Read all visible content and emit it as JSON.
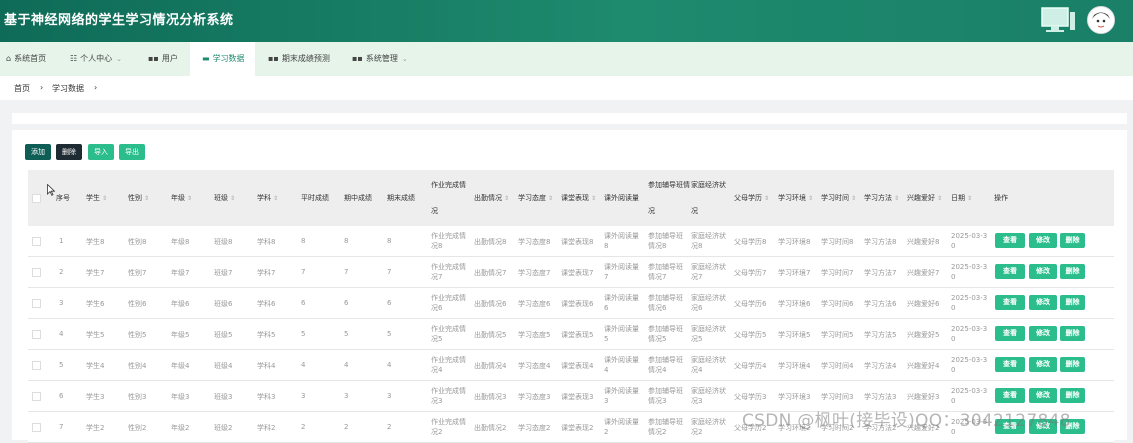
{
  "header": {
    "title": "基于神经网络的学生学习情况分析系统"
  },
  "nav": {
    "items": [
      {
        "label": "系统首页",
        "icon": "home-icon",
        "glyph": "⌂"
      },
      {
        "label": "个人中心",
        "icon": "calendar-icon",
        "glyph": "☷"
      },
      {
        "label": "用户",
        "icon": "grid-icon",
        "glyph": "▪▪"
      },
      {
        "label": "学习数据",
        "icon": "flag-icon",
        "glyph": "▬"
      },
      {
        "label": "期末成绩预测",
        "icon": "grid-icon",
        "glyph": "▪▪"
      },
      {
        "label": "系统管理",
        "icon": "grid-icon",
        "glyph": "▪▪"
      }
    ],
    "caret": "⌄"
  },
  "breadcrumb": {
    "home": "首页",
    "sep": "›",
    "current": "学习数据",
    "sep2": "›"
  },
  "toolbar": {
    "add": "添加",
    "delete": "删除",
    "import": "导入",
    "export": "导出"
  },
  "table": {
    "sort_glyph": "⇕",
    "headers": {
      "index": "序号",
      "student": "学生",
      "gender": "性别",
      "grade": "年级",
      "class": "班级",
      "subject": "学科",
      "usual": "平时成绩",
      "midterm": "期中成绩",
      "final": "期末成绩",
      "homework_a": "作业完成情",
      "homework_b": "况",
      "attendance": "出勤情况",
      "attitude": "学习态度",
      "classroom": "课堂表现",
      "reading": "课外阅读量",
      "tutoring_a": "参加辅导班情",
      "tutoring_b": "况",
      "economy_a": "家庭经济状",
      "economy_b": "况",
      "parent_edu": "父母学历",
      "environment": "学习环境",
      "study_time": "学习时间",
      "method": "学习方法",
      "interest": "兴趣爱好",
      "date": "日期",
      "actions": "操作"
    },
    "rows": [
      {
        "no": "1",
        "n": "8"
      },
      {
        "no": "2",
        "n": "7"
      },
      {
        "no": "3",
        "n": "6"
      },
      {
        "no": "4",
        "n": "5"
      },
      {
        "no": "5",
        "n": "4"
      },
      {
        "no": "6",
        "n": "3"
      },
      {
        "no": "7",
        "n": "2"
      }
    ],
    "row_buttons": {
      "view": "查看",
      "edit": "修改",
      "delete": "删除"
    },
    "date_prefix": "2025-03-3",
    "date_suffix": "0"
  },
  "watermark": "CSDN @枫叶(接毕设)QQ：3042127848",
  "colors": {
    "header": "#1a7d65",
    "nav_bg": "#e6f4ea",
    "accent": "#2bbd8c",
    "dark_btn": "#0f5e56"
  }
}
